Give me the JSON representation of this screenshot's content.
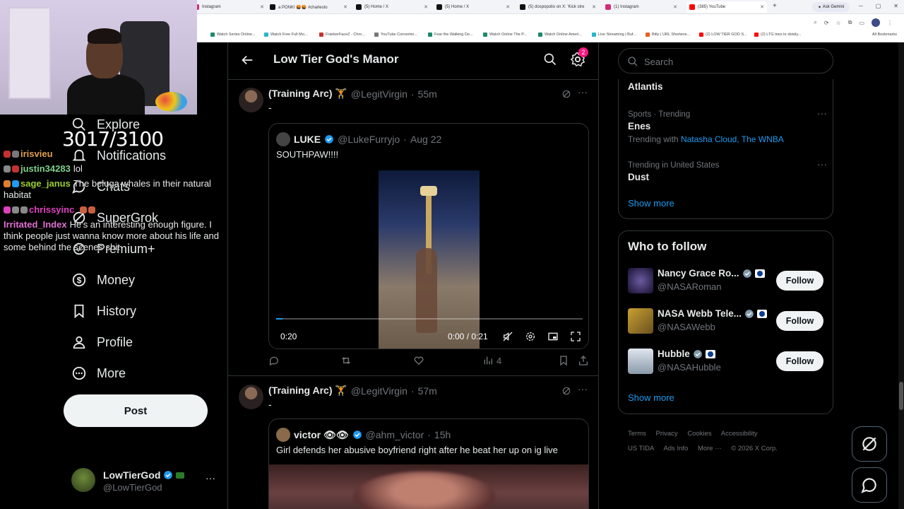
{
  "browser": {
    "tabs": [
      {
        "label": "Instagram",
        "color": "#d62976"
      },
      {
        "label": "a PONK! 🤬🤬 #charlesto",
        "color": "#111111"
      },
      {
        "label": "(5) Home / X",
        "color": "#111111"
      },
      {
        "label": "(5) Home / X",
        "color": "#111111"
      },
      {
        "label": "(5) dospopolio on X: 'Kick stre",
        "color": "#111111"
      },
      {
        "label": "(1) Instagram",
        "color": "#d62976"
      },
      {
        "label": "(385) YouTube",
        "color": "#ff0000"
      }
    ],
    "ask_gemini": "Ask Gemini",
    "bookmarks": [
      "tch",
      "Watch Series Online...",
      "Watch Free Full Mo...",
      "FrankerFaceZ - Chro...",
      "YouTube Converter...",
      "Fear the Walking De...",
      "Watch Online The P...",
      "Watch Online Ameri...",
      "Live Streaming | Buf...",
      "Bitly | URL Shortene...",
      "(2) LOW TIER GOD S...",
      "(2) LTG tries to slowly..."
    ],
    "all_bookmarks": "All Bookmarks"
  },
  "overlay": {
    "counter": "3017/3100",
    "chat": [
      {
        "user": "irisvieu",
        "user_color": "#e0a050",
        "text": ""
      },
      {
        "user": "justin34283",
        "user_color": "#7fd08a",
        "text": "lol"
      },
      {
        "user": "sage_janus",
        "user_color": "#9acd32",
        "text": "The beluga whales in their natural habitat"
      },
      {
        "user": "chrissyinc",
        "user_color": "#e040c0",
        "text": ""
      },
      {
        "user": "Irritated_Index",
        "user_color": "#e070d0",
        "text": "He's an interesting enough figure. I think people just wanna know more about his life and some behind the scenes shit"
      }
    ]
  },
  "leftnav": {
    "items": [
      {
        "label": "Explore",
        "icon": "search-icon"
      },
      {
        "label": "Notifications",
        "icon": "bell-icon"
      },
      {
        "label": "Chats",
        "icon": "chat-icon"
      },
      {
        "label": "SuperGrok",
        "icon": "grok-icon"
      },
      {
        "label": "Premium+",
        "icon": "premium-icon"
      },
      {
        "label": "Money",
        "icon": "dollar-icon"
      },
      {
        "label": "History",
        "icon": "bookmark-icon"
      },
      {
        "label": "Profile",
        "icon": "person-icon"
      },
      {
        "label": "More",
        "icon": "more-circle-icon"
      }
    ],
    "post_label": "Post",
    "account": {
      "name": "LowTierGod",
      "handle": "@LowTierGod"
    }
  },
  "main": {
    "title": "Low Tier God's Manor",
    "settings_badge": "2",
    "posts": [
      {
        "name": "(Training Arc) 🏋",
        "handle": "@LegitVirgin",
        "time": "55m",
        "text": "-",
        "quote": {
          "name": "LUKE",
          "handle": "@LukeFurryjo",
          "time": "Aug 22",
          "text": "SOUTHPAW!!!!",
          "video_countdown": "0:20",
          "video_time": "0:00 / 0:21"
        },
        "views": "4"
      },
      {
        "name": "(Training Arc) 🏋",
        "handle": "@LegitVirgin",
        "time": "57m",
        "text": "-",
        "quote": {
          "name": "victor 👁👁",
          "handle": "@ahm_victor",
          "time": "15h",
          "text": "Girl defends her abusive boyfriend right after he beat her up on ig live"
        }
      }
    ]
  },
  "right": {
    "search_placeholder": "Search",
    "trends": [
      {
        "meta": "",
        "title": "Atlantis",
        "with_label": "",
        "with_links": ""
      },
      {
        "meta": "Sports · Trending",
        "title": "Enes",
        "with_label": "Trending with",
        "with_links": "Natasha Cloud, The WNBA"
      },
      {
        "meta": "Trending in United States",
        "title": "Dust",
        "with_label": "",
        "with_links": ""
      }
    ],
    "show_more": "Show more",
    "who_to_follow": {
      "title": "Who to follow",
      "accounts": [
        {
          "name": "Nancy Grace Ro...",
          "handle": "@NASARoman",
          "follow": "Follow"
        },
        {
          "name": "NASA Webb Tele...",
          "handle": "@NASAWebb",
          "follow": "Follow"
        },
        {
          "name": "Hubble",
          "handle": "@NASAHubble",
          "follow": "Follow"
        }
      ],
      "show_more": "Show more"
    },
    "footer": {
      "links": [
        "Terms",
        "Privacy",
        "Cookies",
        "Accessibility",
        "US TIDA",
        "Ads Info",
        "More ···"
      ],
      "copyright": "© 2026 X Corp."
    }
  }
}
